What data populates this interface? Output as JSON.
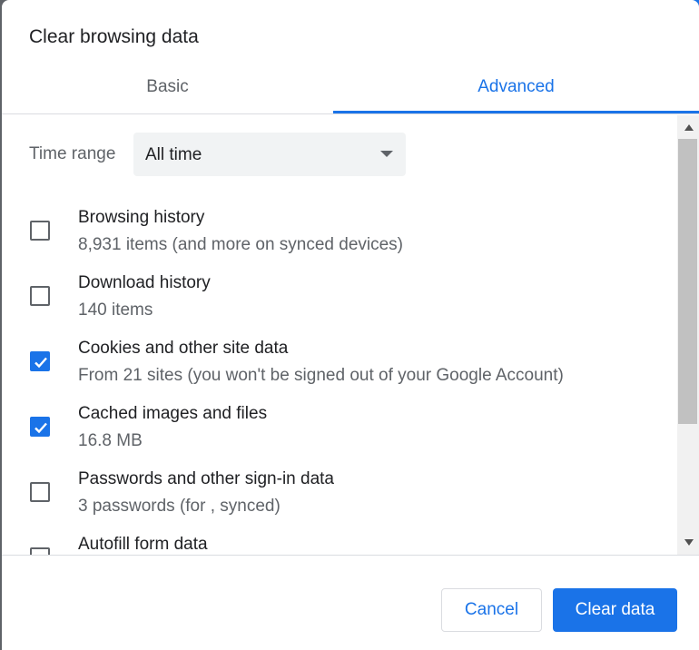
{
  "dialog": {
    "title": "Clear browsing data"
  },
  "tabs": [
    {
      "label": "Basic",
      "selected": false
    },
    {
      "label": "Advanced",
      "selected": true
    }
  ],
  "time_range": {
    "label": "Time range",
    "value": "All time"
  },
  "items": [
    {
      "title": "Browsing history",
      "subtitle": "8,931 items (and more on synced devices)",
      "checked": false
    },
    {
      "title": "Download history",
      "subtitle": "140 items",
      "checked": false
    },
    {
      "title": "Cookies and other site data",
      "subtitle": "From 21 sites (you won't be signed out of your Google Account)",
      "checked": true
    },
    {
      "title": "Cached images and files",
      "subtitle": "16.8 MB",
      "checked": true
    },
    {
      "title": "Passwords and other sign-in data",
      "subtitle": "3 passwords (for , synced)",
      "checked": false
    },
    {
      "title": "Autofill form data",
      "subtitle": "",
      "checked": false
    }
  ],
  "buttons": {
    "cancel_label": "Cancel",
    "clear_label": "Clear data"
  },
  "colors": {
    "accent": "#1a73e8",
    "text_primary": "#202124",
    "text_secondary": "#5f6368"
  },
  "icons": {
    "checkbox_checked": "check-icon",
    "dropdown": "caret-down-icon",
    "scroll_up": "scroll-up-arrow-icon",
    "scroll_down": "scroll-down-arrow-icon"
  }
}
